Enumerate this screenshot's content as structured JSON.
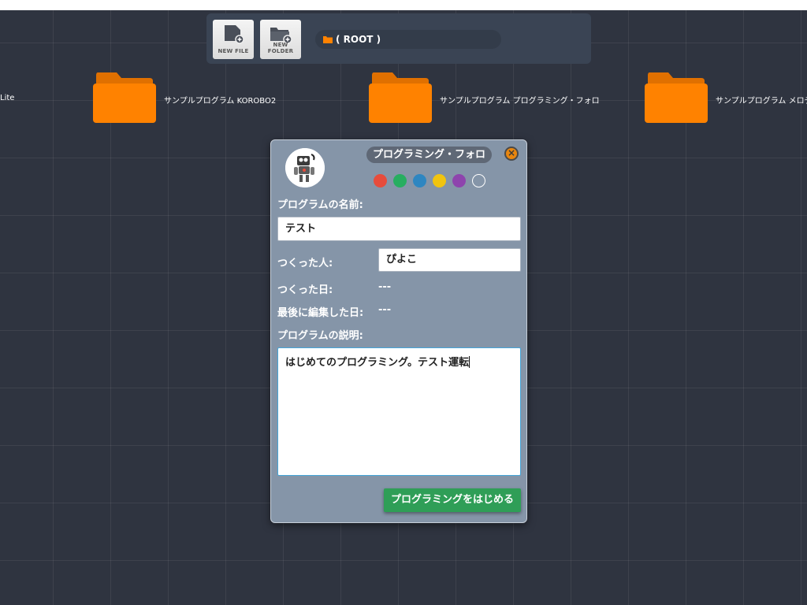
{
  "toolbar": {
    "new_file_label": "NEW FILE",
    "new_folder_label": "NEW FOLDER",
    "path_label": "( ROOT )"
  },
  "folders": [
    {
      "name": "Lite"
    },
    {
      "name": "サンプルプログラム KOROBO2"
    },
    {
      "name": "サンプルプログラム プログラミング・フォロ"
    },
    {
      "name": "サンプルプログラム メロデ"
    }
  ],
  "dialog": {
    "title": "プログラミング・フォロ",
    "close_icon": "close-icon",
    "colors": [
      "#e74c3c",
      "#27ae60",
      "#2e86c1",
      "#f1c40f",
      "#8e44ad",
      "transparent"
    ],
    "program_name_label": "プログラムの名前:",
    "program_name_value": "テスト",
    "author_label": "つくった人:",
    "author_value": "ぴよこ",
    "created_label": "つくった日:",
    "created_value": "---",
    "edited_label": "最後に編集した日:",
    "edited_value": "---",
    "description_label": "プログラムの説明:",
    "description_value": "はじめてのプログラミング。テスト運転",
    "start_button_label": "プログラミングをはじめる"
  },
  "theme": {
    "folder_color": "#ff8200",
    "accent_green": "#2f9e57",
    "close_orange": "#e8860f"
  }
}
